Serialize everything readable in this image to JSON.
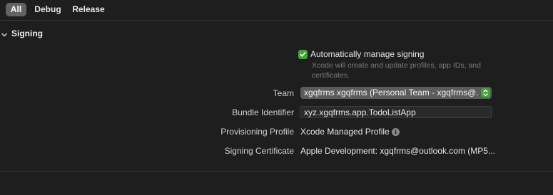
{
  "tabs": [
    {
      "label": "All",
      "selected": true
    },
    {
      "label": "Debug",
      "selected": false
    },
    {
      "label": "Release",
      "selected": false
    }
  ],
  "section": {
    "title": "Signing",
    "expanded": true,
    "chevron_icon": "chevron-down-icon"
  },
  "auto_signing": {
    "label": "Automatically manage signing",
    "checked": true,
    "description": "Xcode will create and update profiles, app IDs, and certificates."
  },
  "fields": {
    "team": {
      "label": "Team",
      "value": "xgqfrms xgqfrms (Personal Team - xgqfrms@..."
    },
    "bundle_identifier": {
      "label": "Bundle Identifier",
      "value": "xyz.xgqfrms.app.TodoListApp"
    },
    "provisioning_profile": {
      "label": "Provisioning Profile",
      "value": "Xcode Managed Profile",
      "info_icon": "info-icon"
    },
    "signing_certificate": {
      "label": "Signing Certificate",
      "value": "Apple Development: xgqfrms@outlook.com (MP5..."
    }
  },
  "colors": {
    "background": "#1e1e1e",
    "accent_green": "#3fa535",
    "selected_tab": "#636366"
  }
}
